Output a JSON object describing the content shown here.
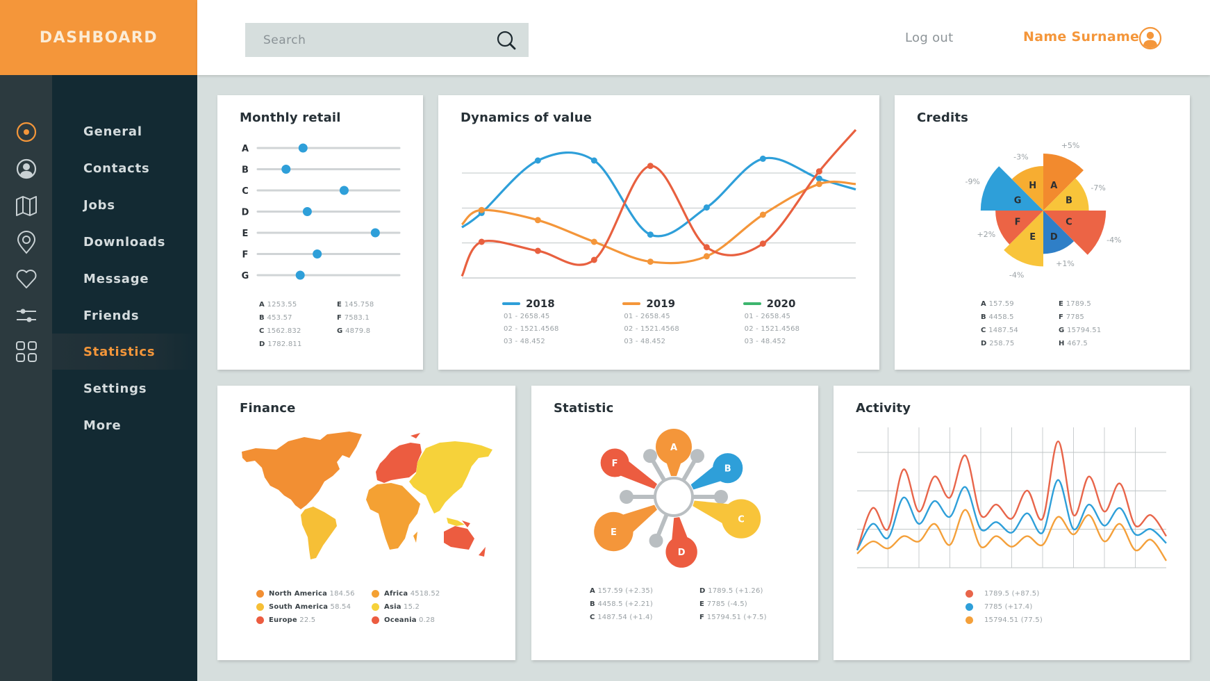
{
  "brand": {
    "title": "DASHBOARD",
    "accent": "#f4963a"
  },
  "topbar": {
    "search_placeholder": "Search",
    "search_value": "",
    "logout_label": "Log out",
    "user_name": "Name Surname"
  },
  "rail": {
    "icons": [
      "target-icon",
      "user-circle-icon",
      "map-icon",
      "location-pin-icon",
      "heart-icon",
      "sliders-icon",
      "grid-icon"
    ]
  },
  "sidebar": {
    "items": [
      {
        "label": "General",
        "active": false
      },
      {
        "label": "Contacts",
        "active": false
      },
      {
        "label": "Jobs",
        "active": false
      },
      {
        "label": "Downloads",
        "active": false
      },
      {
        "label": "Message",
        "active": false
      },
      {
        "label": "Friends",
        "active": false
      },
      {
        "label": "Statistics",
        "active": true
      },
      {
        "label": "Settings",
        "active": false
      },
      {
        "label": "More",
        "active": false
      }
    ]
  },
  "cards": {
    "monthly_retail": {
      "title": "Monthly retail"
    },
    "dynamics": {
      "title": "Dynamics of value"
    },
    "credits": {
      "title": "Credits"
    },
    "finance": {
      "title": "Finance"
    },
    "statistic": {
      "title": "Statistic"
    },
    "activity": {
      "title": "Activity"
    }
  },
  "chart_data": [
    {
      "id": "monthly_retail",
      "type": "scatter",
      "title": "Monthly retail",
      "categories": [
        "A",
        "B",
        "C",
        "D",
        "E",
        "F",
        "G"
      ],
      "slider_positions": [
        0.32,
        0.2,
        0.61,
        0.35,
        0.83,
        0.42,
        0.3
      ],
      "dot_color": "#2e9fd9",
      "legend": [
        {
          "key": "A",
          "value": "1253.55"
        },
        {
          "key": "B",
          "value": "453.57"
        },
        {
          "key": "C",
          "value": "1562.832"
        },
        {
          "key": "D",
          "value": "1782.811"
        },
        {
          "key": "E",
          "value": "145.758"
        },
        {
          "key": "F",
          "value": "7583.1"
        },
        {
          "key": "G",
          "value": "4879.8"
        }
      ]
    },
    {
      "id": "dynamics",
      "type": "line",
      "title": "Dynamics of value",
      "x": [
        0,
        1,
        2,
        3,
        4,
        5,
        6,
        7
      ],
      "ylim": [
        0,
        4
      ],
      "grid": true,
      "series": [
        {
          "name": "2018",
          "color": "#2e9fd9",
          "values": [
            1.8,
            3.25,
            3.25,
            1.2,
            1.95,
            3.3,
            2.75
          ],
          "x": [
            0.35,
            1.35,
            2.35,
            3.35,
            4.35,
            5.35,
            6.35
          ]
        },
        {
          "name": "2019",
          "color": "#f4963a",
          "values": [
            1.88,
            1.6,
            1.0,
            0.45,
            0.6,
            1.75,
            2.6
          ],
          "x": [
            0.35,
            1.35,
            2.35,
            3.35,
            4.35,
            5.35,
            6.35
          ]
        },
        {
          "name": "2020",
          "color": "#e8603f",
          "values": [
            1.0,
            0.75,
            0.5,
            3.1,
            0.85,
            0.95,
            2.95
          ],
          "x": [
            0.35,
            1.35,
            2.35,
            3.35,
            4.35,
            5.35,
            6.35
          ]
        }
      ],
      "legend": [
        {
          "name": "2018",
          "color": "#2e9fd9",
          "rows": [
            "01 - 2658.45",
            "02 - 1521.4568",
            "03 - 48.452"
          ]
        },
        {
          "name": "2019",
          "color": "#f4963a",
          "rows": [
            "01 - 2658.45",
            "02 - 1521.4568",
            "03 - 48.452"
          ]
        },
        {
          "name": "2020",
          "color": "#3db56e",
          "rows": [
            "01 - 2658.45",
            "02 - 1521.4568",
            "03 - 48.452"
          ]
        }
      ]
    },
    {
      "id": "credits",
      "type": "pie",
      "title": "Credits",
      "slices": [
        {
          "label": "A",
          "change": "+5%",
          "radius_rel": 1.0,
          "color": "#f28a2e"
        },
        {
          "label": "B",
          "change": "-7%",
          "radius_rel": 0.8,
          "color": "#f8c43a"
        },
        {
          "label": "C",
          "change": "-4%",
          "radius_rel": 1.1,
          "color": "#ec6445"
        },
        {
          "label": "D",
          "change": "+1%",
          "radius_rel": 0.76,
          "color": "#2f7fc7"
        },
        {
          "label": "E",
          "change": "-4%",
          "radius_rel": 0.98,
          "color": "#f8c43a"
        },
        {
          "label": "F",
          "change": "+2%",
          "radius_rel": 0.84,
          "color": "#ec6445"
        },
        {
          "label": "G",
          "change": "-9%",
          "radius_rel": 1.1,
          "color": "#2e9fd9"
        },
        {
          "label": "H",
          "change": "-3%",
          "radius_rel": 0.78,
          "color": "#f7ad31"
        }
      ],
      "legend": [
        {
          "key": "A",
          "value": "157.59"
        },
        {
          "key": "B",
          "value": "4458.5"
        },
        {
          "key": "C",
          "value": "1487.54"
        },
        {
          "key": "D",
          "value": "258.75"
        },
        {
          "key": "E",
          "value": "1789.5"
        },
        {
          "key": "F",
          "value": "7785"
        },
        {
          "key": "G",
          "value": "15794.51"
        },
        {
          "key": "H",
          "value": "467.5"
        }
      ]
    },
    {
      "id": "finance",
      "type": "heatmap",
      "title": "Finance",
      "regions": [
        {
          "name": "North America",
          "value": "184.56",
          "color": "#f28f33"
        },
        {
          "name": "South America",
          "value": "58.54",
          "color": "#f6bf36"
        },
        {
          "name": "Europe",
          "value": "22.5",
          "color": "#ec5c40"
        },
        {
          "name": "Africa",
          "value": "4518.52",
          "color": "#f4a133"
        },
        {
          "name": "Asia",
          "value": "15.2",
          "color": "#f6d23a"
        },
        {
          "name": "Oceania",
          "value": "0.28",
          "color": "#ec5c40"
        }
      ]
    },
    {
      "id": "statistic",
      "type": "pie",
      "title": "Statistic",
      "nodes": [
        {
          "label": "A",
          "value": "157.59",
          "change": "(+2.35)",
          "color": "#f4963a",
          "size_rel": 1.0
        },
        {
          "label": "B",
          "value": "4458.5",
          "change": "(+2.21)",
          "color": "#2e9fd9",
          "size_rel": 0.8
        },
        {
          "label": "C",
          "value": "1487.54",
          "change": "(+1.4)",
          "color": "#f8c43a",
          "size_rel": 1.1
        },
        {
          "label": "D",
          "value": "1789.5",
          "change": "(+1.26)",
          "color": "#ec5c40",
          "size_rel": 0.85
        },
        {
          "label": "E",
          "value": "7785",
          "change": "(-4.5)",
          "color": "#f4963a",
          "size_rel": 1.1
        },
        {
          "label": "F",
          "value": "15794.51",
          "change": "(+7.5)",
          "color": "#ec5c40",
          "size_rel": 0.75
        }
      ]
    },
    {
      "id": "activity",
      "type": "line",
      "title": "Activity",
      "grid": true,
      "ylim": [
        0,
        4
      ],
      "x_count": 21,
      "series": [
        {
          "name": "1789.5  (+87.5)",
          "color": "#e8654a",
          "values": [
            0.5,
            1.7,
            1.1,
            2.8,
            1.6,
            2.6,
            2.0,
            3.2,
            1.5,
            1.8,
            1.4,
            2.2,
            1.4,
            3.6,
            1.5,
            2.6,
            1.6,
            2.4,
            1.2,
            1.5,
            0.9
          ]
        },
        {
          "name": "7785 (+17.4)",
          "color": "#2e9fd9",
          "values": [
            0.5,
            1.25,
            0.85,
            2.0,
            1.25,
            1.9,
            1.45,
            2.3,
            1.1,
            1.3,
            1.0,
            1.55,
            1.0,
            2.5,
            1.1,
            1.8,
            1.2,
            1.7,
            0.95,
            1.1,
            0.7
          ]
        },
        {
          "name": "15794.51 (77.5)",
          "color": "#f4a03a",
          "values": [
            0.4,
            0.75,
            0.55,
            0.9,
            0.75,
            1.25,
            0.65,
            1.65,
            0.6,
            0.9,
            0.6,
            0.9,
            0.65,
            1.45,
            0.95,
            1.5,
            0.75,
            1.25,
            0.5,
            0.8,
            0.2
          ]
        }
      ]
    }
  ]
}
